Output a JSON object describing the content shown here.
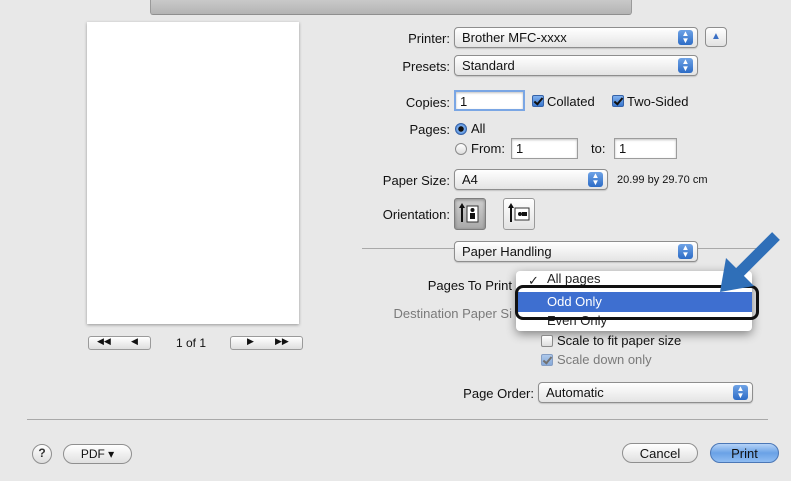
{
  "printer": {
    "label": "Printer:",
    "value": "Brother MFC-xxxx"
  },
  "presets": {
    "label": "Presets:",
    "value": "Standard"
  },
  "copies": {
    "label": "Copies:",
    "value": "1",
    "collated_label": "Collated",
    "two_sided_label": "Two-Sided",
    "collated": true,
    "two_sided": true
  },
  "pages": {
    "label": "Pages:",
    "all_label": "All",
    "from_label": "From:",
    "from_value": "1",
    "to_label": "to:",
    "to_value": "1",
    "selected": "all"
  },
  "paper_size": {
    "label": "Paper Size:",
    "value": "A4",
    "dimensions": "20.99 by 29.70 cm"
  },
  "orientation": {
    "label": "Orientation:",
    "selected": "portrait"
  },
  "section_popup": {
    "value": "Paper Handling"
  },
  "pages_to_print": {
    "label": "Pages To Print",
    "options": [
      "All pages",
      "Odd Only",
      "Even Only"
    ],
    "selected": "Odd Only"
  },
  "destination_paper_size": {
    "label": "Destination Paper Si"
  },
  "scale_to_fit": {
    "label": "Scale to fit paper size",
    "checked": false
  },
  "scale_down_only": {
    "label": "Scale down only",
    "checked": true
  },
  "page_order": {
    "label": "Page Order:",
    "value": "Automatic"
  },
  "preview": {
    "page_indicator": "1 of 1"
  },
  "footer": {
    "help": "?",
    "pdf": "PDF ▾",
    "cancel": "Cancel",
    "print": "Print"
  },
  "colors": {
    "accent": "#3e6fd0",
    "callout_arrow": "#2f6fb8"
  }
}
